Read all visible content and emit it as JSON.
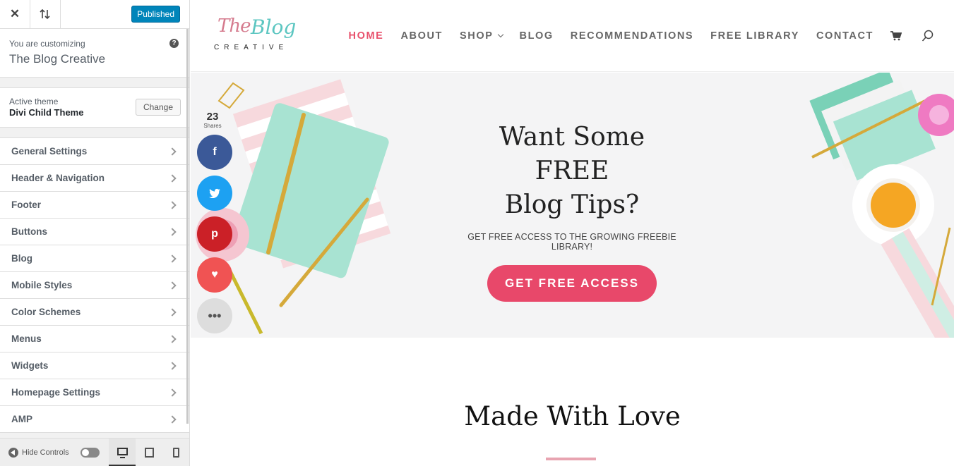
{
  "customizer": {
    "published_label": "Published",
    "customizing_label": "You are customizing",
    "site_name": "The Blog Creative",
    "help_label": "?",
    "active_theme_label": "Active theme",
    "theme_name": "Divi Child Theme",
    "change_label": "Change",
    "menu": [
      {
        "label": "General Settings"
      },
      {
        "label": "Header & Navigation"
      },
      {
        "label": "Footer"
      },
      {
        "label": "Buttons"
      },
      {
        "label": "Blog"
      },
      {
        "label": "Mobile Styles"
      },
      {
        "label": "Color Schemes"
      },
      {
        "label": "Menus"
      },
      {
        "label": "Widgets"
      },
      {
        "label": "Homepage Settings"
      },
      {
        "label": "AMP"
      }
    ],
    "hide_controls_label": "Hide Controls",
    "active_device": "desktop"
  },
  "site": {
    "logo": {
      "script_a": "The",
      "script_b": "Blog",
      "word": "CREATIVE"
    },
    "nav": [
      {
        "label": "HOME",
        "active": true
      },
      {
        "label": "ABOUT",
        "active": false
      },
      {
        "label": "SHOP",
        "active": false,
        "has_dropdown": true
      },
      {
        "label": "BLOG",
        "active": false
      },
      {
        "label": "RECOMMENDATIONS",
        "active": false
      },
      {
        "label": "FREE LIBRARY",
        "active": false
      },
      {
        "label": "CONTACT",
        "active": false
      }
    ],
    "hero": {
      "title_line1": "Want Some FREE",
      "title_line2": "Blog Tips?",
      "subtitle": "GET FREE ACCESS TO THE GROWING FREEBIE LIBRARY!",
      "cta_label": "GET FREE ACCESS"
    },
    "section2": {
      "title": "Made With Love"
    },
    "share": {
      "count": "23",
      "label": "Shares",
      "buttons": [
        "facebook-icon",
        "twitter-icon",
        "pinterest-icon",
        "heart-icon",
        "more-icon"
      ]
    }
  },
  "colors": {
    "accent_pink": "#e8486a",
    "wp_blue": "#0085ba",
    "facebook": "#3b5998",
    "twitter": "#1da1f2",
    "pinterest": "#cb2027",
    "love": "#f05353"
  }
}
